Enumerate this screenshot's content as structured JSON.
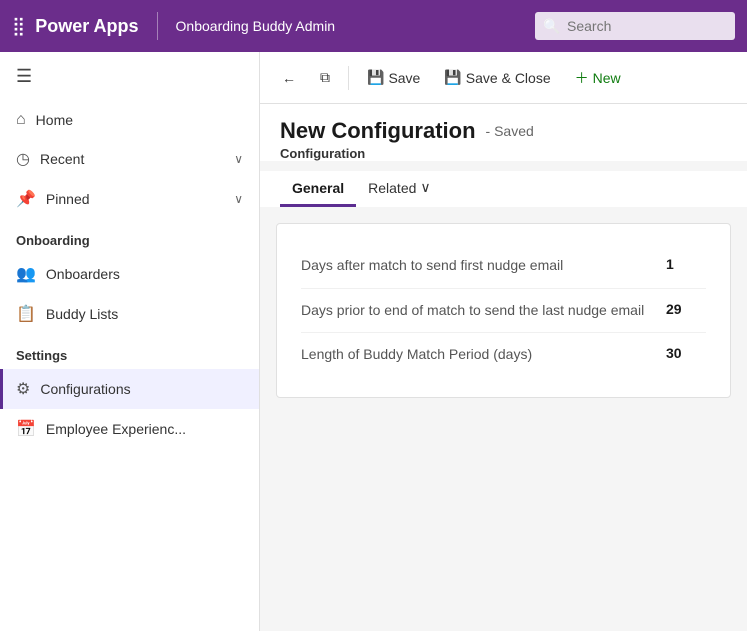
{
  "topbar": {
    "app_name": "Power Apps",
    "context": "Onboarding Buddy Admin",
    "search_placeholder": "Search"
  },
  "sidebar": {
    "hamburger_label": "☰",
    "nav_items": [
      {
        "id": "home",
        "icon": "⌂",
        "label": "Home",
        "has_chevron": false
      },
      {
        "id": "recent",
        "icon": "◷",
        "label": "Recent",
        "has_chevron": true
      },
      {
        "id": "pinned",
        "icon": "📌",
        "label": "Pinned",
        "has_chevron": true
      }
    ],
    "sections": [
      {
        "title": "Onboarding",
        "items": [
          {
            "id": "onboarders",
            "icon": "👥",
            "label": "Onboarders"
          },
          {
            "id": "buddy-lists",
            "icon": "📋",
            "label": "Buddy Lists"
          }
        ]
      },
      {
        "title": "Settings",
        "items": [
          {
            "id": "configurations",
            "icon": "⚙",
            "label": "Configurations",
            "active": true
          },
          {
            "id": "employee-experience",
            "icon": "📅",
            "label": "Employee Experienc..."
          }
        ]
      }
    ]
  },
  "toolbar": {
    "back_label": "←",
    "open_label": "⧉",
    "save_label": "Save",
    "save_close_label": "Save & Close",
    "new_label": "New"
  },
  "page": {
    "title": "New Configuration",
    "saved_status": "- Saved",
    "subtitle": "Configuration"
  },
  "tabs": [
    {
      "id": "general",
      "label": "General",
      "active": true
    },
    {
      "id": "related",
      "label": "Related",
      "active": false
    }
  ],
  "config_fields": [
    {
      "label": "Days after match to send first nudge email",
      "value": "1"
    },
    {
      "label": "Days prior to end of match to send the last nudge email",
      "value": "29"
    },
    {
      "label": "Length of Buddy Match Period (days)",
      "value": "30"
    }
  ]
}
